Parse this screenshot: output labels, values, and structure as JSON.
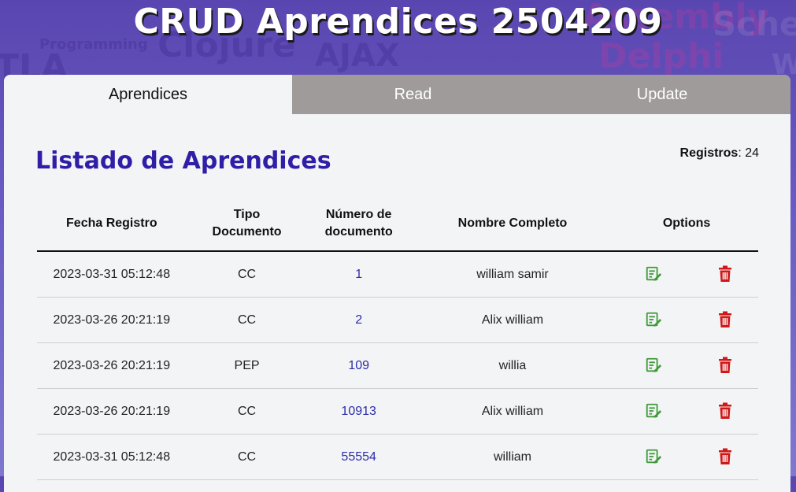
{
  "page": {
    "title": "CRUD Aprendices 2504209",
    "background_words": [
      "Programming",
      "Clojure",
      "AJAX",
      "Assembly",
      "Delphi",
      "Sche",
      "TLA",
      "W"
    ]
  },
  "tabs": [
    {
      "label": "Aprendices",
      "active": true
    },
    {
      "label": "Read",
      "active": false
    },
    {
      "label": "Update",
      "active": false
    }
  ],
  "main": {
    "heading": "Listado de Aprendices",
    "count_label": "Registros",
    "count_value": "24"
  },
  "table": {
    "headers": {
      "fecha": "Fecha Registro",
      "tipo_line1": "Tipo",
      "tipo_line2": "Documento",
      "numero_line1": "Número de",
      "numero_line2": "documento",
      "nombre": "Nombre Completo",
      "options": "Options"
    },
    "rows": [
      {
        "fecha": "2023-03-31 05:12:48",
        "tipo": "CC",
        "numero": "1",
        "nombre": "william samir"
      },
      {
        "fecha": "2023-03-26 20:21:19",
        "tipo": "CC",
        "numero": "2",
        "nombre": "Alix william"
      },
      {
        "fecha": "2023-03-26 20:21:19",
        "tipo": "PEP",
        "numero": "109",
        "nombre": "willia"
      },
      {
        "fecha": "2023-03-26 20:21:19",
        "tipo": "CC",
        "numero": "10913",
        "nombre": "Alix william"
      },
      {
        "fecha": "2023-03-31 05:12:48",
        "tipo": "CC",
        "numero": "55554",
        "nombre": "william"
      }
    ]
  },
  "icons": {
    "edit": "edit-icon",
    "delete": "trash-icon"
  },
  "colors": {
    "accent": "#2f1ea6",
    "number_link": "#2c2ca8",
    "edit_green": "#3f9a3a",
    "delete_red": "#d01818",
    "inactive_tab": "#a09b9b"
  }
}
